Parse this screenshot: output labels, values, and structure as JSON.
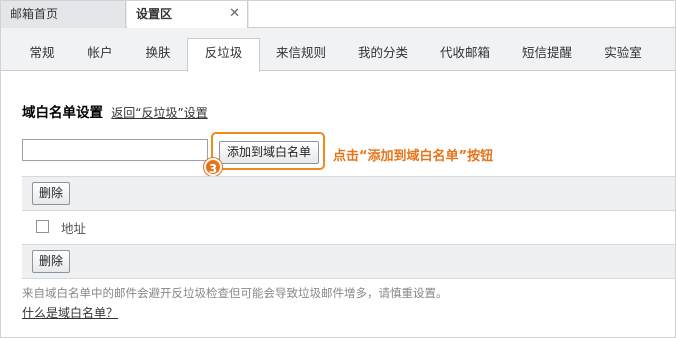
{
  "top_tabs": {
    "home": "邮箱首页",
    "settings": "设置区",
    "close_glyph": "✕"
  },
  "nav": {
    "items": [
      "常规",
      "帐户",
      "换肤",
      "反垃圾",
      "来信规则",
      "我的分类",
      "代收邮箱",
      "短信提醒",
      "实验室"
    ],
    "active_index": 3
  },
  "section": {
    "title": "域白名单设置",
    "back_link": "返回“反垃圾”设置"
  },
  "add_form": {
    "input_value": "",
    "add_button": "添加到域白名单",
    "step_badge": "3",
    "hint": "点击“添加到域白名单”按钮"
  },
  "list": {
    "delete_button": "删除",
    "column_header": "地址"
  },
  "footer": {
    "note": "来自域白名单中的邮件会避开反垃圾检查但可能会导致垃圾邮件增多，请慎重设置。",
    "faq_link": "什么是域白名单？"
  },
  "colors": {
    "accent": "#e8741a",
    "tab_bar": "#e9ebee",
    "nav_bar": "#f0f2f4"
  }
}
